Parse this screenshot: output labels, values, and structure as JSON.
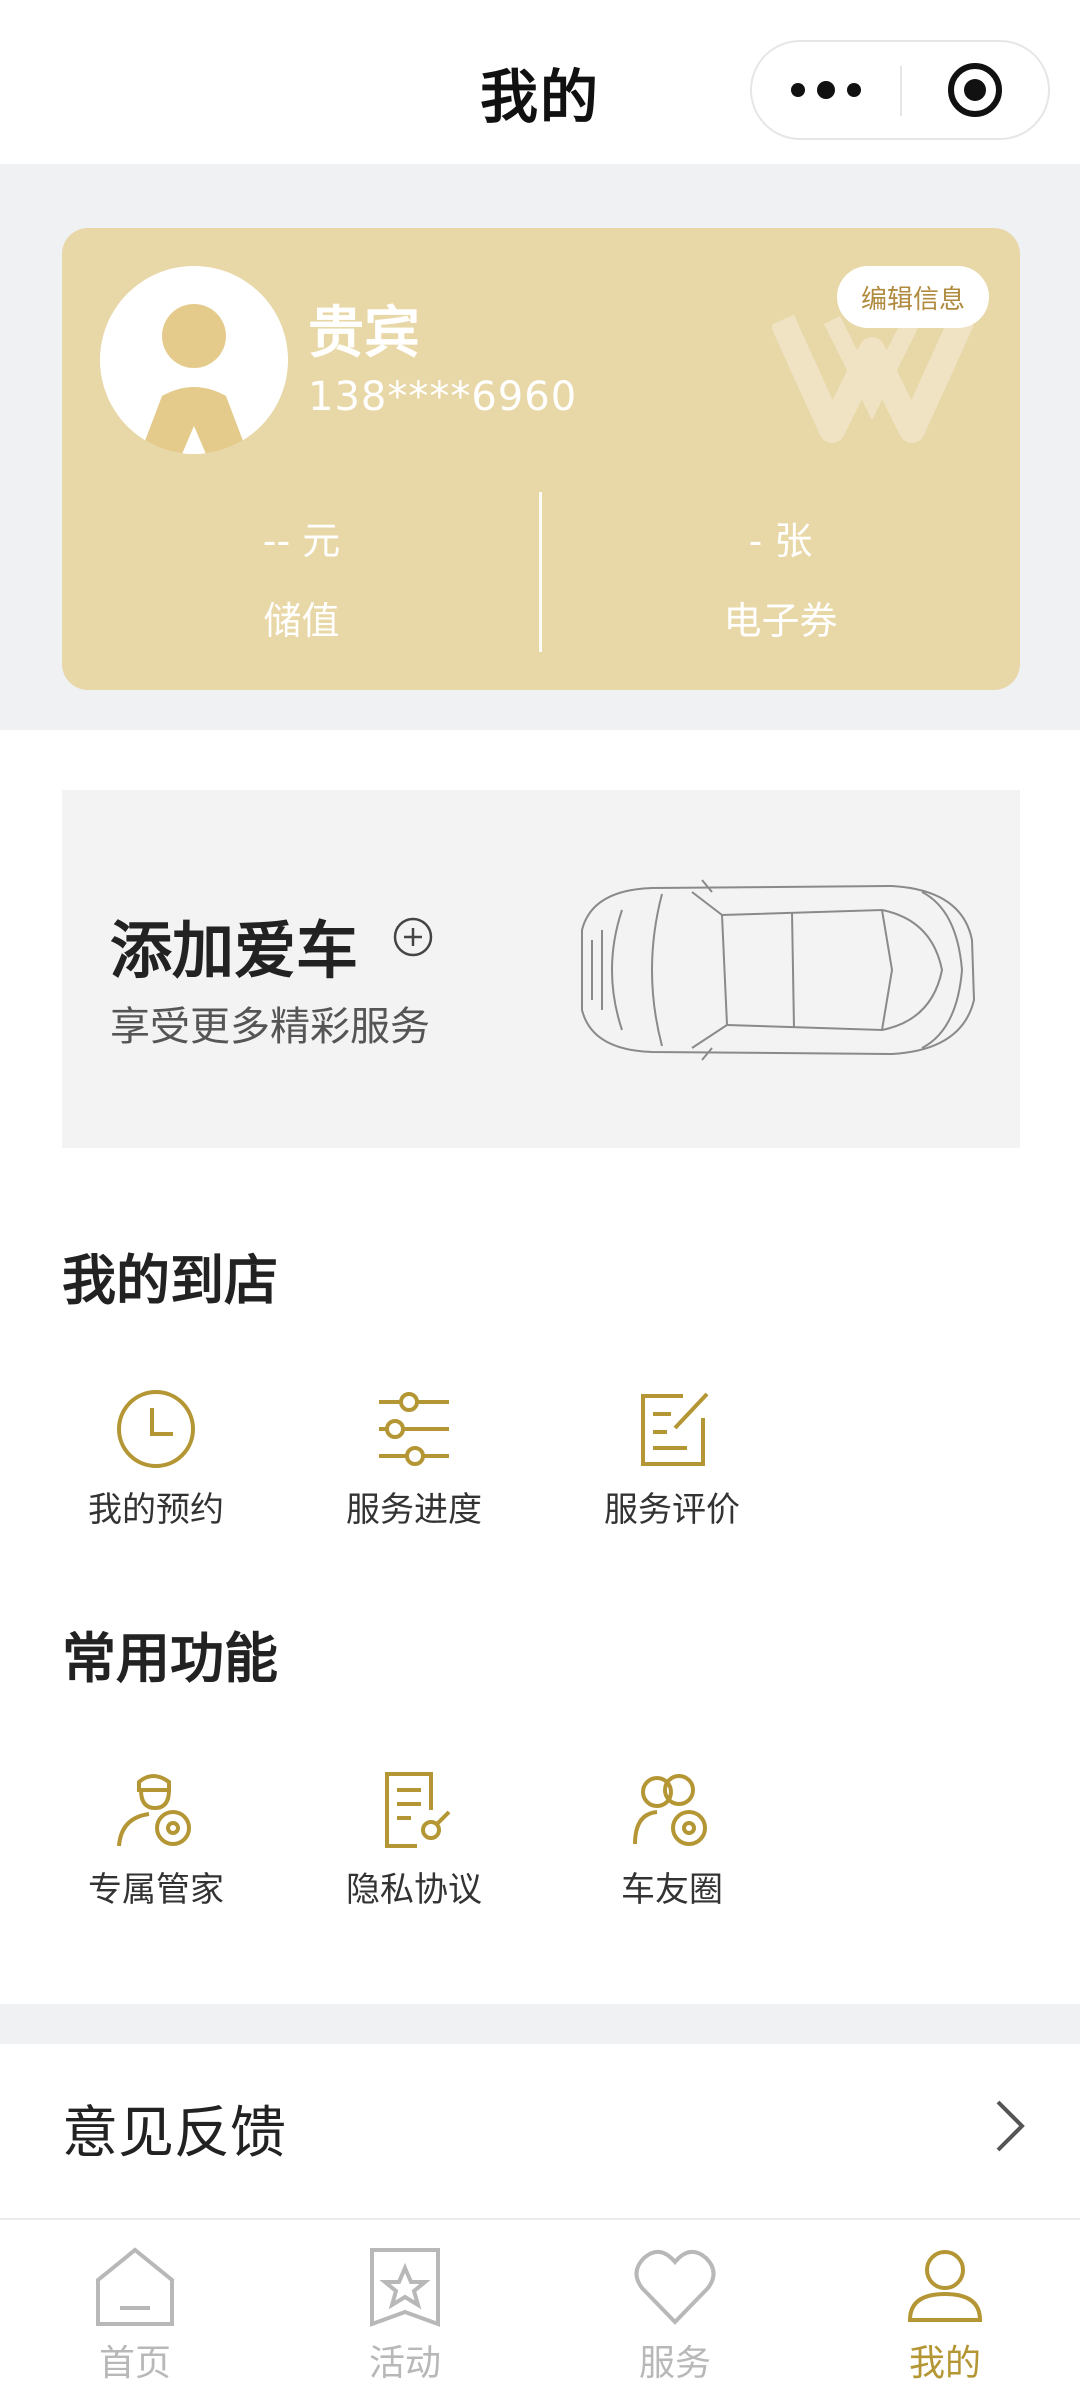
{
  "header": {
    "title": "我的"
  },
  "member_card": {
    "name": "贵宾",
    "phone": "138****6960",
    "edit_label": "编辑信息",
    "stored_value": {
      "value": "-- 元",
      "label": "储值"
    },
    "coupons": {
      "value": "-  张",
      "label": "电子券"
    }
  },
  "add_car": {
    "title": "添加爱车",
    "subtitle": "享受更多精彩服务"
  },
  "my_visits": {
    "title": "我的到店",
    "items": [
      {
        "label": "我的预约",
        "icon": "clock-icon"
      },
      {
        "label": "服务进度",
        "icon": "sliders-icon"
      },
      {
        "label": "服务评价",
        "icon": "edit-note-icon"
      }
    ]
  },
  "common_functions": {
    "title": "常用功能",
    "items": [
      {
        "label": "专属管家",
        "icon": "butler-icon"
      },
      {
        "label": "隐私协议",
        "icon": "document-icon"
      },
      {
        "label": "车友圈",
        "icon": "users-icon"
      }
    ]
  },
  "feedback": {
    "label": "意见反馈"
  },
  "tabbar": {
    "items": [
      {
        "label": "首页",
        "icon": "home-icon"
      },
      {
        "label": "活动",
        "icon": "star-icon"
      },
      {
        "label": "服务",
        "icon": "heart-icon"
      },
      {
        "label": "我的",
        "icon": "user-icon",
        "active": true
      }
    ]
  },
  "colors": {
    "gold": "#b49634",
    "card": "#e8d7a7",
    "inactive": "#b8b8b8"
  }
}
